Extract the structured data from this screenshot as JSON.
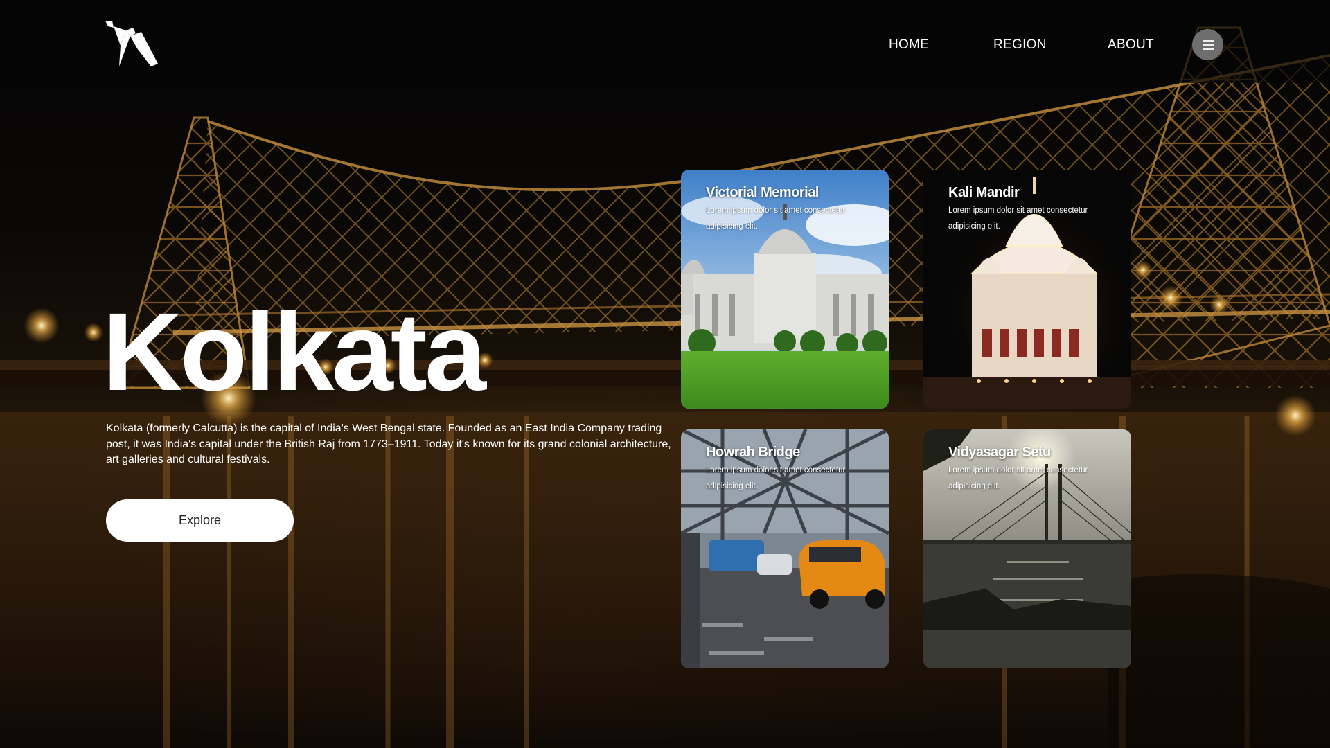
{
  "nav": {
    "items": [
      {
        "label": "HOME"
      },
      {
        "label": "REGION"
      },
      {
        "label": "ABOUT"
      }
    ],
    "menu_icon": "hamburger-icon"
  },
  "logo_icon": "origami-horse-icon",
  "hero": {
    "title": "Kolkata",
    "description": "Kolkata (formerly Calcutta) is the capital of India's West Bengal state. Founded as an East India Company trading post, it was India's capital under the British Raj from 1773–1911. Today it's known for its grand colonial architecture, art galleries and cultural festivals.",
    "cta_label": "Explore"
  },
  "cards": [
    {
      "title": "Victorial Memorial",
      "text": "Lorem ipsum dolor sit amet consectetur adipisicing elit."
    },
    {
      "title": "Kali Mandir",
      "text": "Lorem ipsum dolor sit amet consectetur adipisicing elit."
    },
    {
      "title": "Howrah Bridge",
      "text": "Lorem ipsum dolor sit amet consectetur adipisicing elit."
    },
    {
      "title": "Vidyasagar Setu",
      "text": "Lorem ipsum dolor sit amet consectetur adipisicing elit."
    }
  ],
  "colors": {
    "background": "#050403",
    "bridge_glow": "#c9892c",
    "button_bg": "#ffffff",
    "menu_button_bg": "#6e6e6e"
  }
}
